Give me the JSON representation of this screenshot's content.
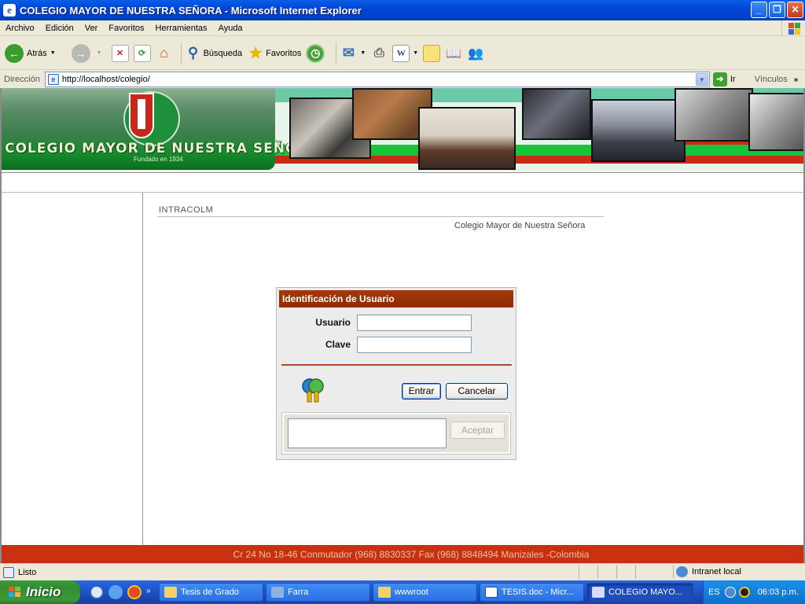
{
  "window": {
    "title": "COLEGIO MAYOR DE NUESTRA SEÑORA - Microsoft Internet Explorer",
    "icon": "ie-icon"
  },
  "menu": [
    "Archivo",
    "Edición",
    "Ver",
    "Favoritos",
    "Herramientas",
    "Ayuda"
  ],
  "toolbar": {
    "back_label": "Atrás",
    "search_label": "Búsqueda",
    "favorites_label": "Favoritos"
  },
  "address": {
    "label": "Dirección",
    "url": "http://localhost/colegio/",
    "go_label": "Ir",
    "links_label": "Vínculos"
  },
  "banner": {
    "school_name": "COLEGIO MAYOR DE NUESTRA SEÑORA",
    "founded": "Fundado en 1934"
  },
  "page": {
    "section_title": "INTRACOLM",
    "school_name": "Colegio Mayor de Nuestra Señora"
  },
  "login": {
    "header": "Identificación de Usuario",
    "user_label": "Usuario",
    "user_value": "",
    "password_label": "Clave",
    "password_value": "",
    "enter_label": "Entrar",
    "cancel_label": "Cancelar",
    "accept_label": "Aceptar",
    "message": ""
  },
  "footer": {
    "address": "Cr 24 No 18-46 Conmutador (968) 8830337 Fax (968) 8848494 Manizales -Colombia"
  },
  "status": {
    "text": "Listo",
    "zone": "Intranet local"
  },
  "taskbar": {
    "start_label": "Inicio",
    "tasks": [
      "Tesis de Grado",
      "Farra",
      "wwwroot",
      "TESIS.doc - Micr...",
      "COLEGIO MAYO..."
    ],
    "lang": "ES",
    "clock": "06:03 p.m."
  },
  "colors": {
    "titlebar": "#0046d5",
    "login_header": "#9a3404",
    "footer": "#c9300f",
    "banner_green": "#19c43a",
    "banner_red": "#c82b18"
  }
}
